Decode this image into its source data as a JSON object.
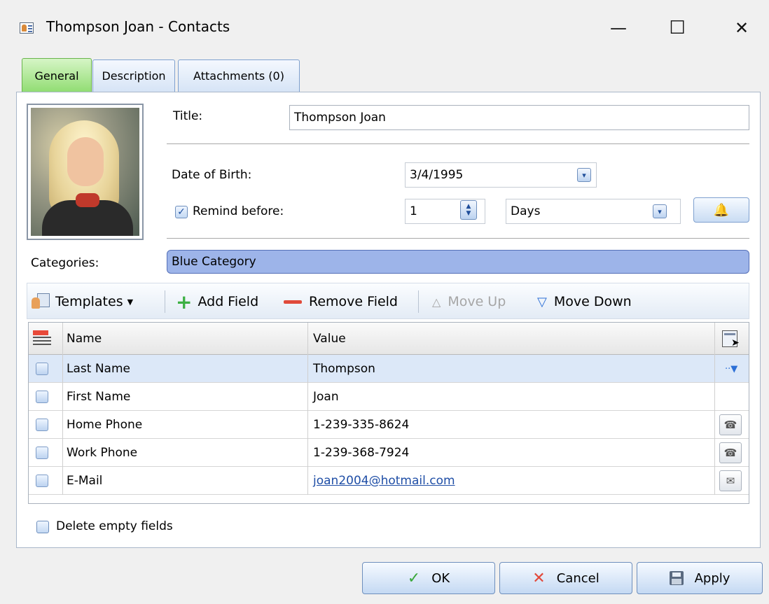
{
  "window": {
    "title": "Thompson Joan - Contacts",
    "minimize": "—",
    "maximize": "☐",
    "close": "✕"
  },
  "tabs": [
    {
      "label": "General",
      "active": true
    },
    {
      "label": "Description",
      "active": false
    },
    {
      "label": "Attachments (0)",
      "active": false
    }
  ],
  "form": {
    "title_label": "Title:",
    "title_value": "Thompson Joan",
    "dob_label": "Date of Birth:",
    "dob_value": "3/4/1995",
    "remind_label": "Remind before:",
    "remind_checked": true,
    "remind_value": "1",
    "remind_unit": "Days",
    "categories_label": "Categories:",
    "categories_value": "Blue Category"
  },
  "toolbar": {
    "templates": "Templates",
    "add_field": "Add Field",
    "remove_field": "Remove Field",
    "move_up": "Move Up",
    "move_down": "Move Down"
  },
  "grid": {
    "columns": [
      "Name",
      "Value"
    ],
    "rows": [
      {
        "name": "Last Name",
        "value": "Thompson",
        "selected": true,
        "button": "more-icon"
      },
      {
        "name": "First Name",
        "value": "Joan",
        "selected": false,
        "button": null
      },
      {
        "name": "Home Phone",
        "value": "1-239-335-8624",
        "selected": false,
        "button": "phone-icon"
      },
      {
        "name": "Work Phone",
        "value": "1-239-368-7924",
        "selected": false,
        "button": "phone-icon"
      },
      {
        "name": "E-Mail",
        "value": "joan2004@hotmail.com",
        "selected": false,
        "button": "mail-icon",
        "link": true
      }
    ]
  },
  "delete_empty_label": "Delete empty fields",
  "buttons": {
    "ok": "OK",
    "cancel": "Cancel",
    "apply": "Apply"
  },
  "colors": {
    "active_tab": "#8fdc70",
    "category": "#9db4e9",
    "selected_row": "#dce8f8",
    "link": "#1f4ea6"
  }
}
